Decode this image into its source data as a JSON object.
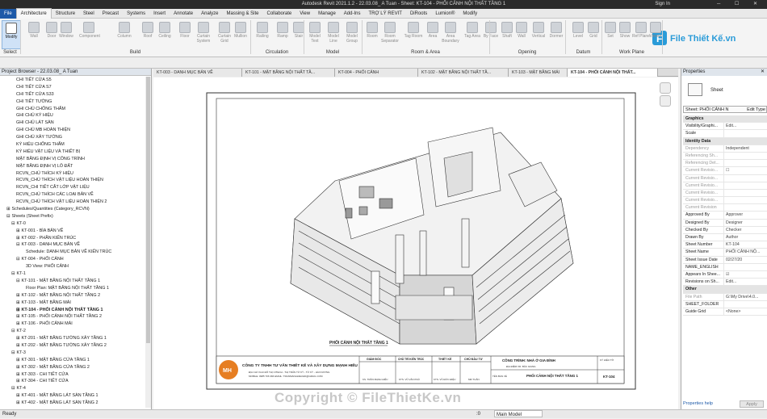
{
  "titlebar": {
    "title": "Autodesk Revit 2021.1.2 - 22.03.08_ A Tuan - Sheet: KT-104 - PHỐI CẢNH NỘI THẤT TẦNG 1",
    "signin": "Sign In"
  },
  "menu": [
    "File",
    "Architecture",
    "Structure",
    "Steel",
    "Precast",
    "Systems",
    "Insert",
    "Annotate",
    "Analyze",
    "Massing & Site",
    "Collaborate",
    "View",
    "Manage",
    "Add-Ins",
    "TRỢ LÝ REVIT",
    "DiRoots",
    "Lumion®",
    "Modify"
  ],
  "ribbon": {
    "buttons": [
      "Modify",
      "Wall",
      "Door",
      "Window",
      "Component",
      "Column",
      "Roof",
      "Ceiling",
      "Floor",
      "Curtain System",
      "Curtain Grid",
      "Mullion",
      "Railing",
      "Ramp",
      "Stair",
      "Model Text",
      "Model Line",
      "Model Group",
      "Room",
      "Room Separator",
      "Tag Room",
      "Area",
      "Area Boundary",
      "Tag Area",
      "By Face",
      "Shaft",
      "Wall",
      "Vertical",
      "Dormer",
      "Level",
      "Grid",
      "Set",
      "Show",
      "Ref Plane",
      "Viewer"
    ],
    "panels": [
      "Select",
      "Build",
      "Circulation",
      "Model",
      "Room & Area",
      "Opening",
      "Datum",
      "Work Plane"
    ]
  },
  "browser": {
    "title": "Project Browser - 22.03.08_ A Tuan",
    "rows": [
      {
        "t": "CHI TIẾT CỬA S5",
        "i": 3
      },
      {
        "t": "CHI TIẾT CỬA S7",
        "i": 3
      },
      {
        "t": "CHI TIẾT CỬA S33",
        "i": 3
      },
      {
        "t": "CHI TIẾT TƯỜNG",
        "i": 3
      },
      {
        "t": "GHI CHÚ CHỐNG THẤM",
        "i": 3
      },
      {
        "t": "GHI CHÚ KÝ HIỆU",
        "i": 3
      },
      {
        "t": "GHI CHÚ LÁT SÀN",
        "i": 3
      },
      {
        "t": "GHI CHÚ MB HOÀN THIỆN",
        "i": 3
      },
      {
        "t": "GHI CHÚ XÂY TƯỜNG",
        "i": 3
      },
      {
        "t": "KÝ HIỆU CHỐNG THẤM",
        "i": 3
      },
      {
        "t": "KÝ HIỆU VẬT LIỆU VÀ THIẾT BỊ",
        "i": 3
      },
      {
        "t": "MẶT BẰNG ĐỊNH VỊ CÔNG TRÌNH",
        "i": 3
      },
      {
        "t": "MẶT BẰNG ĐỊNH VỊ LÔ ĐẤT",
        "i": 3
      },
      {
        "t": "RCVN_CHÚ THÍCH KÝ HIỆU",
        "i": 3
      },
      {
        "t": "RCVN_CHÚ THÍCH VẬT LIỆU HOÀN THIỆN",
        "i": 3
      },
      {
        "t": "RCVN_CHI TIẾT CẮT LỚP VẬT LIỆU",
        "i": 3
      },
      {
        "t": "RCVN_CHÚ THÍCH CÁC LOẠI BẢN VẼ",
        "i": 3
      },
      {
        "t": "RCVN_CHÚ THÍCH VẬT LIỆU HOÀN THIỆN 2",
        "i": 3
      },
      {
        "t": "Schedules/Quantities (Category_RCVN)",
        "i": 1,
        "e": "⊞"
      },
      {
        "t": "Sheets (Sheet Prefix)",
        "i": 1,
        "e": "⊟"
      },
      {
        "t": "KT-0",
        "i": 2,
        "e": "⊟"
      },
      {
        "t": "KT-001 - BÌA BẢN VẼ",
        "i": 3,
        "e": "⊞"
      },
      {
        "t": "KT-002 - PHẦN KIẾN TRÚC",
        "i": 3,
        "e": "⊞"
      },
      {
        "t": "KT-003 - DANH MỤC BẢN VẼ",
        "i": 3,
        "e": "⊟"
      },
      {
        "t": "Schedule: DANH MỤC BẢN VẼ KIẾN TRÚC",
        "i": 5
      },
      {
        "t": "KT-004 - PHỐI CẢNH",
        "i": 3,
        "e": "⊟"
      },
      {
        "t": "3D View: PHỐI CẢNH",
        "i": 5
      },
      {
        "t": "KT-1",
        "i": 2,
        "e": "⊟"
      },
      {
        "t": "KT-101 - MẶT BẰNG NỘI THẤT TẦNG 1",
        "i": 3,
        "e": "⊟"
      },
      {
        "t": "Floor Plan: MẶT BẰNG NỘI THẤT TẦNG 1",
        "i": 5
      },
      {
        "t": "KT-102 - MẶT BẰNG NỘI THẤT TẦNG 2",
        "i": 3,
        "e": "⊞"
      },
      {
        "t": "KT-103 - MẶT BẰNG MÁI",
        "i": 3,
        "e": "⊞"
      },
      {
        "t": "KT-104 - PHỐI CẢNH NỘI THẤT TẦNG 1",
        "i": 3,
        "e": "⊞",
        "s": true
      },
      {
        "t": "KT-105 - PHỐI CẢNH NỘI THẤT TẦNG 2",
        "i": 3,
        "e": "⊞"
      },
      {
        "t": "KT-106 - PHỐI CẢNH MÁI",
        "i": 3,
        "e": "⊞"
      },
      {
        "t": "KT-2",
        "i": 2,
        "e": "⊟"
      },
      {
        "t": "KT-201 - MẶT BẰNG TƯỜNG XÂY TẦNG 1",
        "i": 3,
        "e": "⊞"
      },
      {
        "t": "KT-202 - MẶT BẰNG TƯỜNG XÂY TẦNG 2",
        "i": 3,
        "e": "⊞"
      },
      {
        "t": "KT-3",
        "i": 2,
        "e": "⊟"
      },
      {
        "t": "KT-301 - MẶT BẰNG CỬA TẦNG 1",
        "i": 3,
        "e": "⊞"
      },
      {
        "t": "KT-302 - MẶT BẰNG CỬA TẦNG 2",
        "i": 3,
        "e": "⊞"
      },
      {
        "t": "KT-303 - CHI TIẾT CỬA",
        "i": 3,
        "e": "⊞"
      },
      {
        "t": "KT-304 - CHI TIẾT CỬA",
        "i": 3,
        "e": "⊞"
      },
      {
        "t": "KT-4",
        "i": 2,
        "e": "⊟"
      },
      {
        "t": "KT-401 - MẶT BẰNG LÁT SÀN TẦNG 1",
        "i": 3,
        "e": "⊞"
      },
      {
        "t": "KT-402 - MẶT BẰNG LÁT SÀN TẦNG 2",
        "i": 3,
        "e": "⊞"
      }
    ]
  },
  "tabs": [
    "KT-003 - DANH MỤC BẢN VẼ",
    "KT-101 - MẶT BẰNG NỘI THẤT TẦ...",
    "KT-004 - PHỐI CẢNH",
    "KT-102 - MẶT BẰNG NỘI THẤT TẦ...",
    "KT-103 - MẶT BẰNG MÁI",
    "KT-104 - PHỐI CẢNH NỘI THẤT..."
  ],
  "sheet": {
    "view_title": "PHỐI CẢNH NỘI THẤT TẦNG 1",
    "company": "CÔNG TY TNHH TƯ VẤN THIẾT KẾ VÀ XÂY DỰNG MẠNH HIẾU",
    "company_addr1": "ĐỊA CHỈ: KHU ĐÔ THỊ CITECH - THỊ TRẤN TỨ KỲ - TỨ KỲ - HẢI DƯƠNG",
    "company_addr2": "MOBILE: 0985 706 366 EMAIL: TRANMANHHIEUHD@GMAIL.COM",
    "logo": "MH",
    "c1": "GIÁM ĐỐC",
    "c1s": "KS. TRẦN MẠNH HIẾU",
    "c2": "CHỦ TRÌ KIẾN TRÚC",
    "c2s": "KTS. VŨ VĂN PHÚ",
    "c3": "THIẾT KẾ",
    "c3s": "KTS. VŨ ĐỨC ĐIỆU",
    "c4": "CHỦ ĐẦU TƯ",
    "c4s": "MR TUẤN",
    "project": "CÔNG TRÌNH: NHÀ Ở GIA ĐÌNH",
    "location": "ĐỊA ĐIỂM XD: BẮC GIANG",
    "sheetname_label": "TÊN BẢN VẼ",
    "sheetname": "PHỐI CẢNH NỘI THẤT TẦNG 1",
    "sheetno_label": "KÝ HIỆU TỜ",
    "sheetno": "KT-104"
  },
  "props": {
    "title": "Properties",
    "type": "Sheet",
    "selector": "Sheet: PHỐI CẢNH N",
    "edit_type": "Edit Type",
    "rows": [
      {
        "k": "Graphics",
        "g": true
      },
      {
        "k": "Visibility/Graphi...",
        "v": "Edit..."
      },
      {
        "k": "Scale",
        "v": ""
      },
      {
        "k": "Identity Data",
        "g": true
      },
      {
        "k": "Dependency",
        "v": "Independent",
        "d": true
      },
      {
        "k": "Referencing Sh...",
        "v": "",
        "d": true
      },
      {
        "k": "Referencing Det...",
        "v": "",
        "d": true
      },
      {
        "k": "Current Revisio...",
        "v": "☐",
        "d": true
      },
      {
        "k": "Current Revisio...",
        "v": "",
        "d": true
      },
      {
        "k": "Current Revisio...",
        "v": "",
        "d": true
      },
      {
        "k": "Current Revisio...",
        "v": "",
        "d": true
      },
      {
        "k": "Current Revisio...",
        "v": "",
        "d": true
      },
      {
        "k": "Current Revision",
        "v": "",
        "d": true
      },
      {
        "k": "Approved By",
        "v": "Approver"
      },
      {
        "k": "Designed By",
        "v": "Designer"
      },
      {
        "k": "Checked By",
        "v": "Checker"
      },
      {
        "k": "Drawn By",
        "v": "Author"
      },
      {
        "k": "Sheet Number",
        "v": "KT-104"
      },
      {
        "k": "Sheet Name",
        "v": "PHỐI CẢNH NỘ..."
      },
      {
        "k": "Sheet Issue Date",
        "v": "02/27/20"
      },
      {
        "k": "NAME_ENGLISH",
        "v": ""
      },
      {
        "k": "Appears In Shee...",
        "v": "☑"
      },
      {
        "k": "Revisions on Sh...",
        "v": "Edit..."
      },
      {
        "k": "Other",
        "g": true
      },
      {
        "k": "File Path",
        "v": "G:\\My Drive\\4.0...",
        "d": true
      },
      {
        "k": "SHEET_FOLDER",
        "v": ""
      },
      {
        "k": "Guide Grid",
        "v": "<None>"
      }
    ],
    "help": "Properties help",
    "apply": "Apply"
  },
  "status": {
    "left": "Ready",
    "scale": ":0",
    "model": "Main Model"
  },
  "watermark": "Copyright © FileThietKe.vn",
  "logo_text": "File Thiết Kế.vn"
}
